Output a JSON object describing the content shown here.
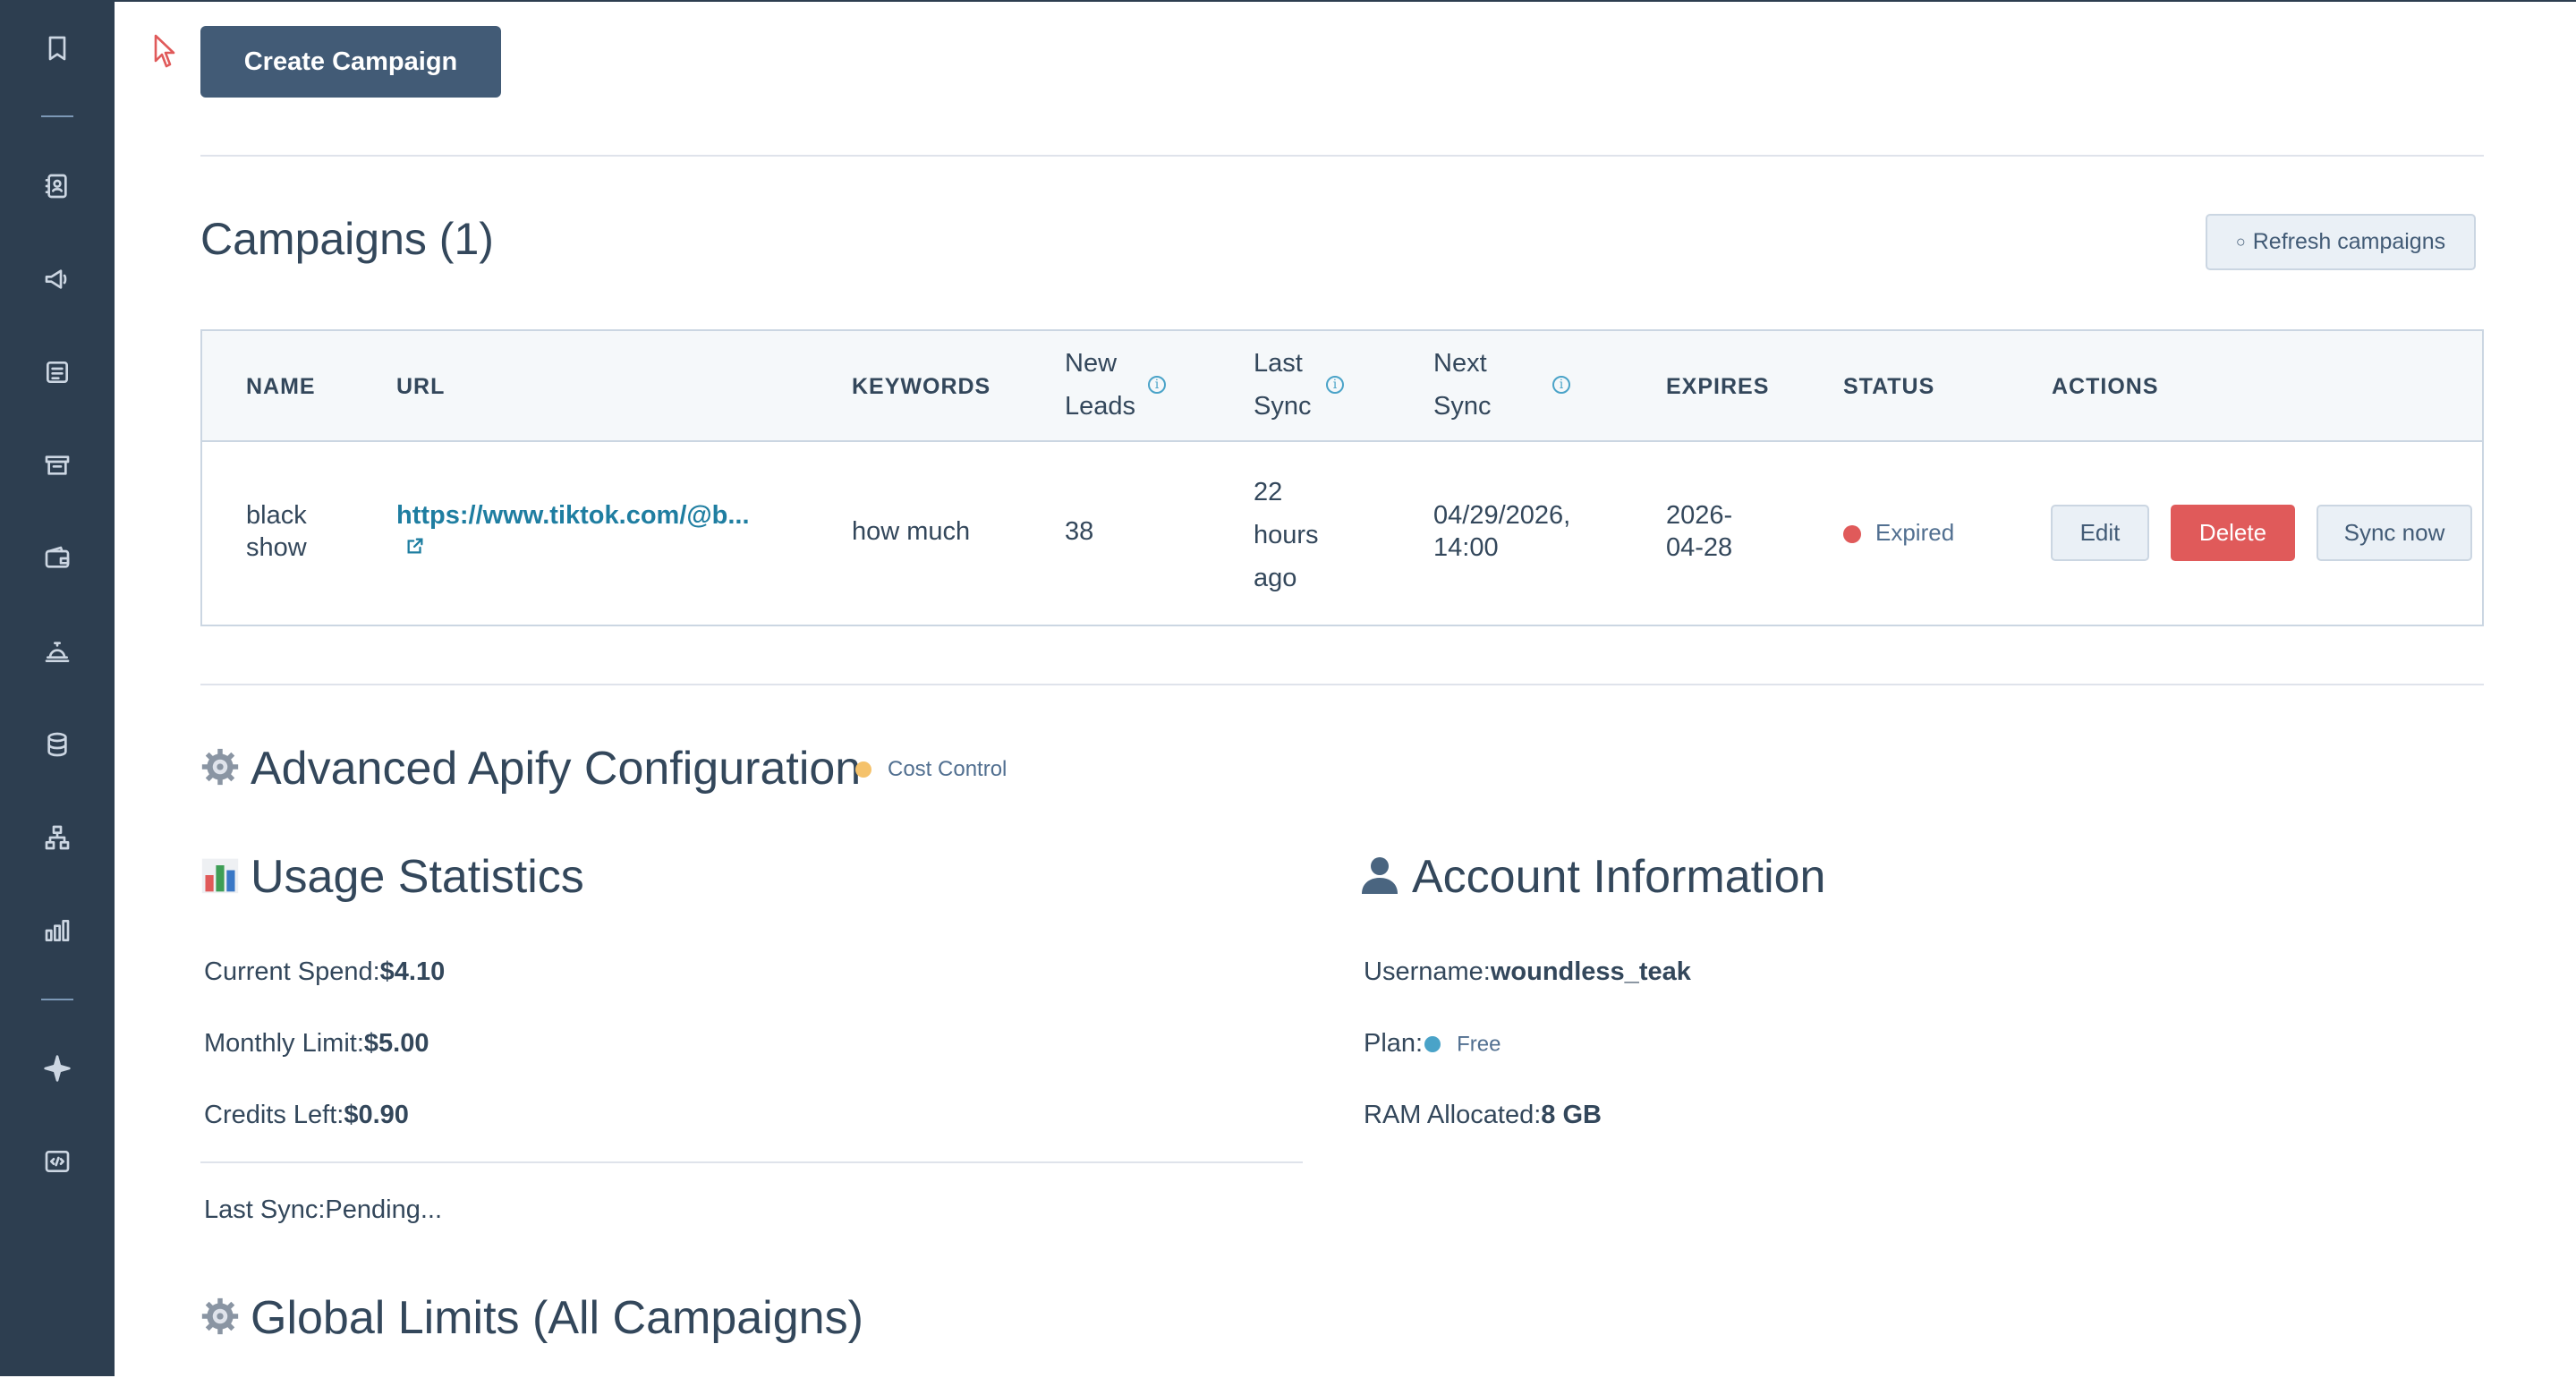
{
  "sidebar": {
    "icons": [
      "bookmark-icon",
      "contacts-icon",
      "megaphone-icon",
      "content-icon",
      "commerce-icon",
      "wallet-icon",
      "service-bell-icon",
      "database-icon",
      "workflow-icon",
      "reports-icon",
      "sparkle-icon",
      "code-icon"
    ]
  },
  "toolbar": {
    "create_label": "Create Campaign"
  },
  "campaigns": {
    "title": "Campaigns (1)",
    "refresh_label": "Refresh campaigns",
    "refresh_icon": "○",
    "headers": {
      "name": "NAME",
      "url": "URL",
      "keywords": "KEYWORDS",
      "new_leads_1": "New",
      "new_leads_2": "Leads",
      "last_sync_1": "Last",
      "last_sync_2": "Sync",
      "next_sync_1": "Next",
      "next_sync_2": "Sync",
      "expires": "EXPIRES",
      "status": "STATUS",
      "actions": "ACTIONS"
    },
    "rows": [
      {
        "name_1": "black",
        "name_2": "show",
        "url": "https://www.tiktok.com/@b...",
        "keywords": "how much",
        "new_leads": "38",
        "last_sync_1": "22",
        "last_sync_2": "hours",
        "last_sync_3": "ago",
        "next_sync_1": "04/29/2026,",
        "next_sync_2": "14:00",
        "expires_1": "2026-",
        "expires_2": "04-28",
        "status": "Expired",
        "edit_label": "Edit",
        "delete_label": "Delete",
        "sync_label": "Sync now"
      }
    ]
  },
  "apify": {
    "title": "Advanced Apify Configuration",
    "tag": "Cost Control",
    "tag_color": "#f5c26b"
  },
  "usage": {
    "title": "Usage Statistics",
    "current_spend_label": "Current Spend:",
    "current_spend_value": "$4.10",
    "monthly_limit_label": "Monthly Limit:",
    "monthly_limit_value": "$5.00",
    "credits_left_label": "Credits Left:",
    "credits_left_value": "$0.90",
    "last_sync_label": "Last Sync:",
    "last_sync_value": "Pending..."
  },
  "account": {
    "title": "Account Information",
    "username_label": "Username:",
    "username_value": "woundless_teak",
    "plan_label": "Plan:",
    "plan_value": "Free",
    "ram_label": "RAM Allocated:",
    "ram_value": "8 GB"
  },
  "global_limits": {
    "title": "Global Limits (All Campaigns)"
  },
  "colors": {
    "sidebar": "#2d3e50",
    "primary_button": "#425b76",
    "danger": "#e05a5a",
    "link": "#1f7ea1"
  }
}
